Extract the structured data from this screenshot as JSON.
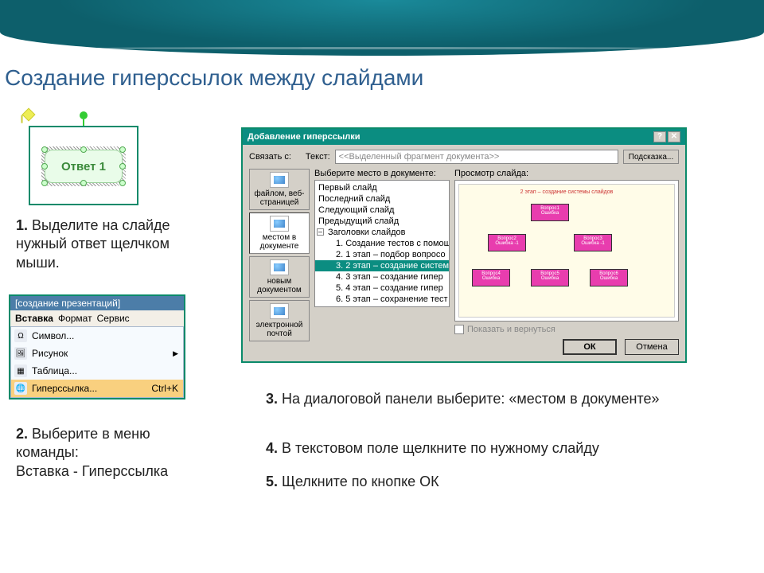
{
  "title": "Создание гиперссылок между слайдами",
  "illus1": {
    "button_label": "Ответ 1"
  },
  "steps": {
    "s1_num": "1.",
    "s1_text": " Выделите на слайде нужный ответ щелчком мыши.",
    "s2_num": "2.",
    "s2_text": " Выберите в меню команды:",
    "s2_text2": "Вставка - Гиперссылка",
    "s3_num": "3.",
    "s3_text": " На диалоговой панели выберите: «местом в документе»",
    "s4_num": "4.",
    "s4_text": " В текстовом поле щелкните по нужному слайду",
    "s5_num": "5.",
    "s5_text": " Щелкните по кнопке ОК"
  },
  "menu": {
    "bar_title": "[создание презентаций]",
    "tabs": [
      "Вставка",
      "Формат",
      "Сервис"
    ],
    "items": [
      {
        "label": "Символ...",
        "arrow": false
      },
      {
        "label": "Рисунок",
        "arrow": true
      },
      {
        "label": "Таблица...",
        "arrow": false
      },
      {
        "label": "Гиперссылка...",
        "shortcut": "Ctrl+K",
        "arrow": false
      }
    ]
  },
  "dialog": {
    "title": "Добавление гиперссылки",
    "link_with_label": "Связать с:",
    "text_label": "Текст:",
    "text_value": "<<Выделенный фрагмент документа>>",
    "tip_btn": "Подсказка...",
    "choose_place_label": "Выберите место в документе:",
    "preview_label": "Просмотр слайда:",
    "side": [
      "файлом, веб-страницей",
      "местом в документе",
      "новым документом",
      "электронной почтой"
    ],
    "tree": {
      "root_items": [
        "Первый слайд",
        "Последний слайд",
        "Следующий слайд",
        "Предыдущий слайд"
      ],
      "header": "Заголовки слайдов",
      "subs": [
        "1. Создание тестов с помощ",
        "2. 1 этап – подбор вопросо",
        "3. 2 этап – создание систем",
        "4. 3 этап – создание гипер",
        "5. 4 этап – создание гипер",
        "6. 5 этап – сохранение тест"
      ],
      "selected_index": 2
    },
    "preview_title": "2 этап – создание системы слайдов",
    "nodes": [
      {
        "l": "Вопрос1 Ошибка"
      },
      {
        "l": "Вопрос2 Ошибка -1"
      },
      {
        "l": "Вопрос3 Ошибка -1"
      },
      {
        "l": "Вопрос4 Ошибка"
      },
      {
        "l": "Вопрос5 Ошибка"
      },
      {
        "l": "Вопрос6 Ошибка"
      }
    ],
    "show_return": "Показать и вернуться",
    "ok": "ОК",
    "cancel": "Отмена"
  }
}
